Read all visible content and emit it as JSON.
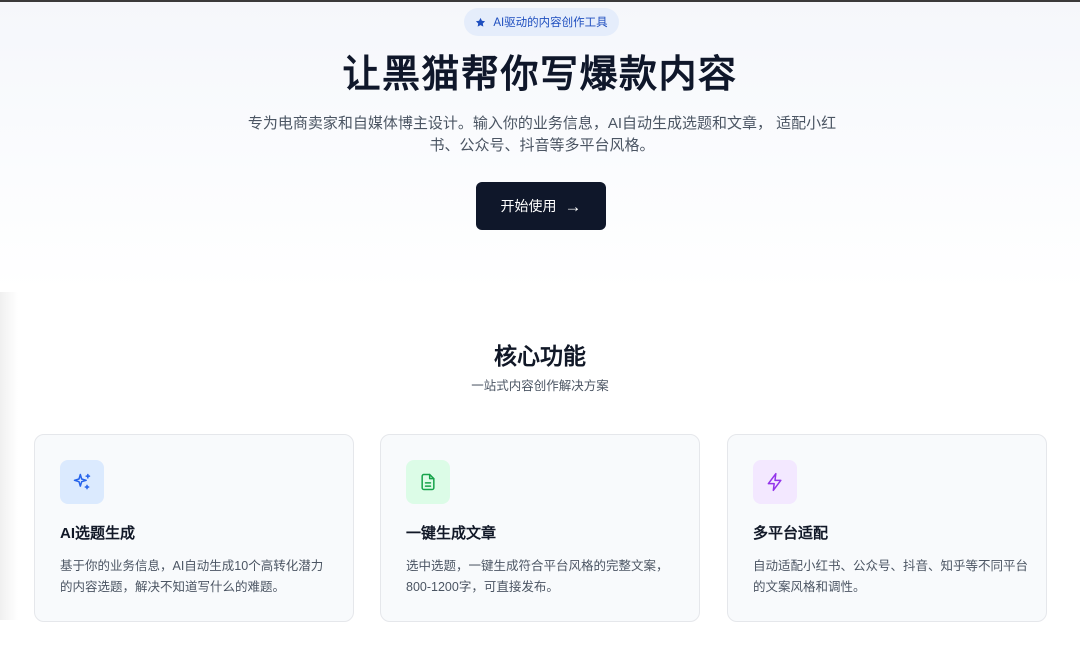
{
  "hero": {
    "badge": {
      "icon": "star-icon",
      "label": "AI驱动的内容创作工具"
    },
    "title": "让黑猫帮你写爆款内容",
    "description": "专为电商卖家和自媒体博主设计。输入你的业务信息，AI自动生成选题和文章， 适配小红书、公众号、抖音等多平台风格。",
    "cta": {
      "label": "开始使用",
      "arrow": "→"
    }
  },
  "features": {
    "title": "核心功能",
    "subtitle": "一站式内容创作解决方案",
    "cards": [
      {
        "icon": "sparkles-icon",
        "icon_color": "#2563eb",
        "icon_bg": "#dbeafe",
        "title": "AI选题生成",
        "description": "基于你的业务信息，AI自动生成10个高转化潜力的内容选题，解决不知道写什么的难题。"
      },
      {
        "icon": "document-icon",
        "icon_color": "#16a34a",
        "icon_bg": "#dcfce7",
        "title": "一键生成文章",
        "description": "选中选题，一键生成符合平台风格的完整文案，800-1200字，可直接发布。"
      },
      {
        "icon": "lightning-icon",
        "icon_color": "#9333ea",
        "icon_bg": "#f3e8ff",
        "title": "多平台适配",
        "description": "自动适配小红书、公众号、抖音、知乎等不同平台的文案风格和调性。"
      }
    ]
  }
}
